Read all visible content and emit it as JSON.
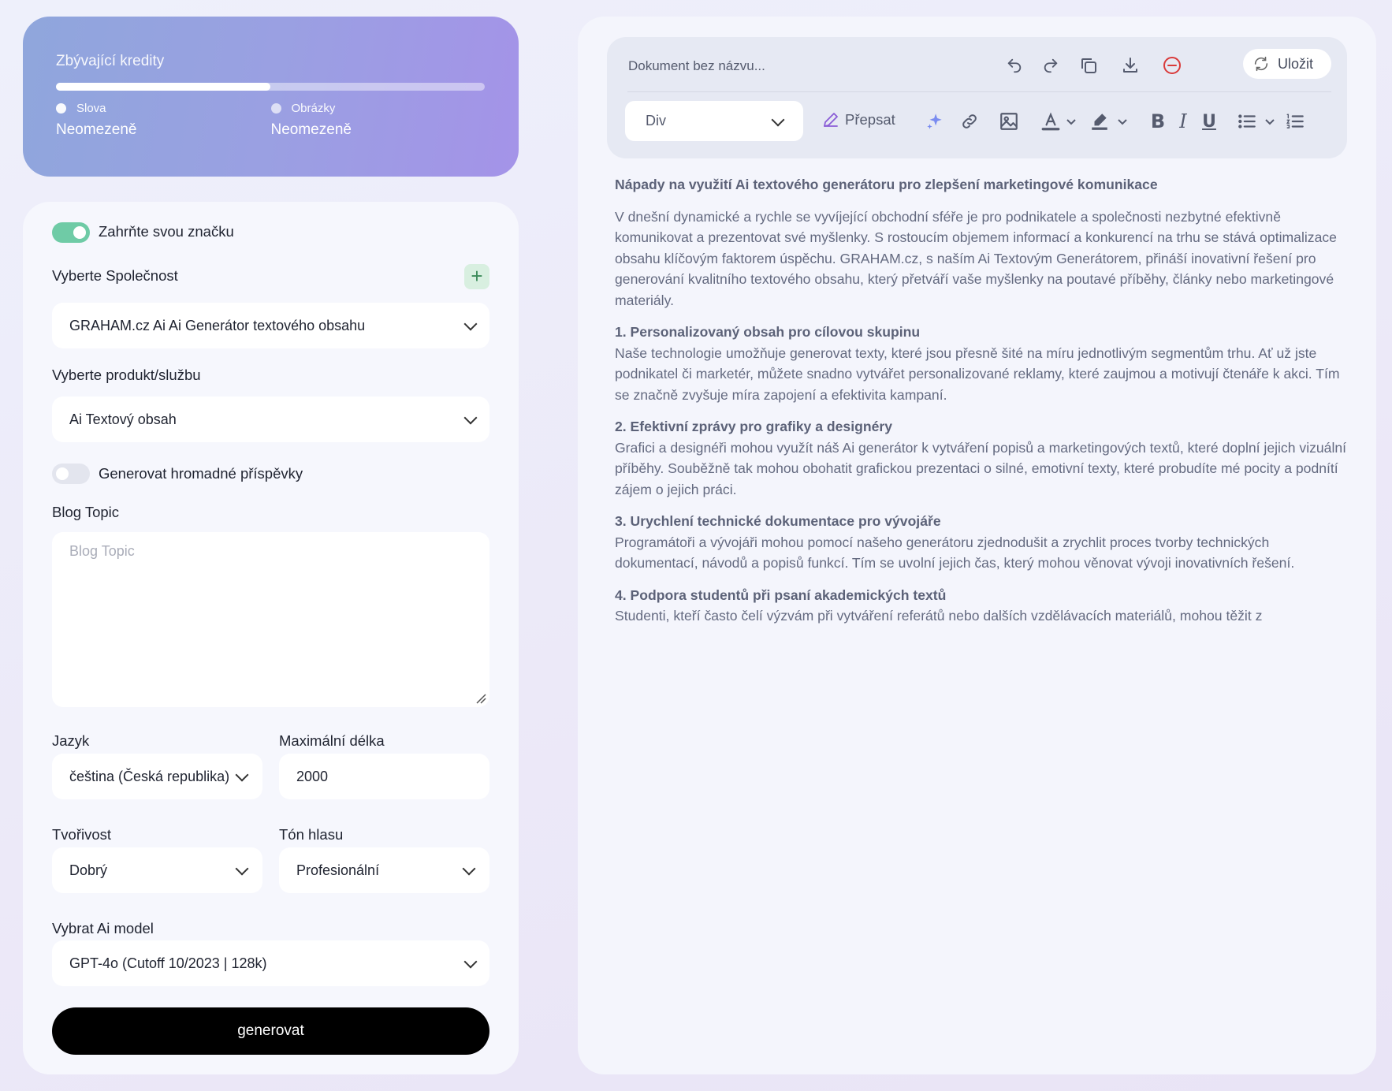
{
  "credits": {
    "title": "Zbývající kredity",
    "progress_fraction": 0.5,
    "words_label": "Slova",
    "words_value": "Neomezeně",
    "images_label": "Obrázky",
    "images_value": "Neomezeně"
  },
  "form": {
    "brand_toggle_label": "Zahrňte svou značku",
    "brand_toggle_on": true,
    "company_label": "Vyberte Společnost",
    "company_value": "GRAHAM.cz Ai Ai Generátor textového obsahu",
    "product_label": "Vyberte produkt/službu",
    "product_value": "Ai Textový obsah",
    "bulk_toggle_label": "Generovat hromadné příspěvky",
    "bulk_toggle_on": false,
    "topic_label": "Blog Topic",
    "topic_placeholder": "Blog Topic",
    "language_label": "Jazyk",
    "language_value": "čeština (Česká republika)",
    "maxlen_label": "Maximální délka",
    "maxlen_value": "2000",
    "creativity_label": "Tvořivost",
    "creativity_value": "Dobrý",
    "tone_label": "Tón hlasu",
    "tone_value": "Profesionální",
    "model_label": "Vybrat Ai model",
    "model_value": "GPT-4o (Cutoff 10/2023 | 128k)",
    "generate_label": "generovat"
  },
  "editor": {
    "doc_name_placeholder": "Dokument bez názvu...",
    "save_label": "Uložit",
    "block_type": "Div",
    "rewrite_label": "Přepsat",
    "colors": {
      "accent": "#6fcba6",
      "delete": "#d93a3a",
      "rewrite_icon": "#8a5cd6",
      "sparkle": "#7a8cf0"
    },
    "heading": "Nápady na využití Ai textového generátoru pro zlepšení marketingové komunikace",
    "intro": "V dnešní dynamické a rychle se vyvíjející obchodní sféře je pro podnikatele a společnosti nezbytné efektivně komunikovat a prezentovat své myšlenky. S rostoucím objemem informací a konkurencí na trhu se stává optimalizace obsahu klíčovým faktorem úspěchu. GRAHAM.cz, s naším Ai Textovým Generátorem, přináší inovativní řešení pro generování kvalitního textového obsahu, který přetváří vaše myšlenky na poutavé příběhy, články nebo marketingové materiály.",
    "sections": [
      {
        "title": "1. Personalizovaný obsah pro cílovou skupinu",
        "body": "Naše technologie umožňuje generovat texty, které jsou přesně šité na míru jednotlivým segmentům trhu. Ať už jste podnikatel či marketér, můžete snadno vytvářet personalizované reklamy, které zaujmou a motivují čtenáře k akci. Tím se značně zvyšuje míra zapojení a efektivita kampaní."
      },
      {
        "title": "2. Efektivní zprávy pro grafiky a designéry",
        "body": "Grafici a designéři mohou využít náš Ai generátor k vytváření popisů a marketingových textů, které doplní jejich vizuální příběhy. Souběžně tak mohou obohatit grafickou prezentaci o silné, emotivní texty, které probudíte mé pocity a podnítí zájem o jejich práci."
      },
      {
        "title": "3. Urychlení technické dokumentace pro vývojáře",
        "body": "Programátoři a vývojáři mohou pomocí našeho generátoru zjednodušit a zrychlit proces tvorby technických dokumentací, návodů a popisů funkcí. Tím se uvolní jejich čas, který mohou věnovat vývoji inovativních řešení."
      },
      {
        "title": "4. Podpora studentů při psaní akademických textů",
        "body": "Studenti, kteří často čelí výzvám při vytváření referátů nebo dalších vzdělávacích materiálů, mohou těžit z"
      }
    ]
  }
}
